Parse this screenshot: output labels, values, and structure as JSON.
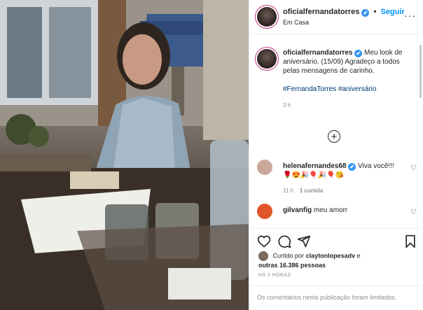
{
  "post": {
    "username": "oficialfernandatorres",
    "follow_label": "Seguir",
    "location": "Em Casa",
    "more_label": "···",
    "caption_text": "Meu look de aniversário. (15/09) Agradeço a todos pelas mensagens de carinho.",
    "hashtags": [
      "#FernandaTorres",
      "#aniversário"
    ],
    "caption_time": "3 h"
  },
  "comments": [
    {
      "username": "helenafernandes68",
      "verified": true,
      "text": "Viva você!!!🌹😍🎉🎈🎉🎈😘",
      "time": "11 h",
      "likes": "1 curtida",
      "avatar_color": "#c9a99a"
    },
    {
      "username": "gilvanfig",
      "verified": false,
      "text": "meu amorr",
      "time": "",
      "likes": "",
      "avatar_color": "#e0562a"
    }
  ],
  "icons": {
    "verified": "✔",
    "add_comments": "+",
    "heart": "♡",
    "like": "heart-icon",
    "comment": "comment-icon",
    "share": "share-icon",
    "save": "bookmark-icon"
  },
  "likes": {
    "prefix": "Curtido por",
    "user": "claytonlopesadv",
    "connector": "e",
    "others": "outras 16.386 pessoas"
  },
  "timestamp": "HÁ 3 HORAS",
  "comments_limited": "Os comentários nesta publicação foram limitados."
}
